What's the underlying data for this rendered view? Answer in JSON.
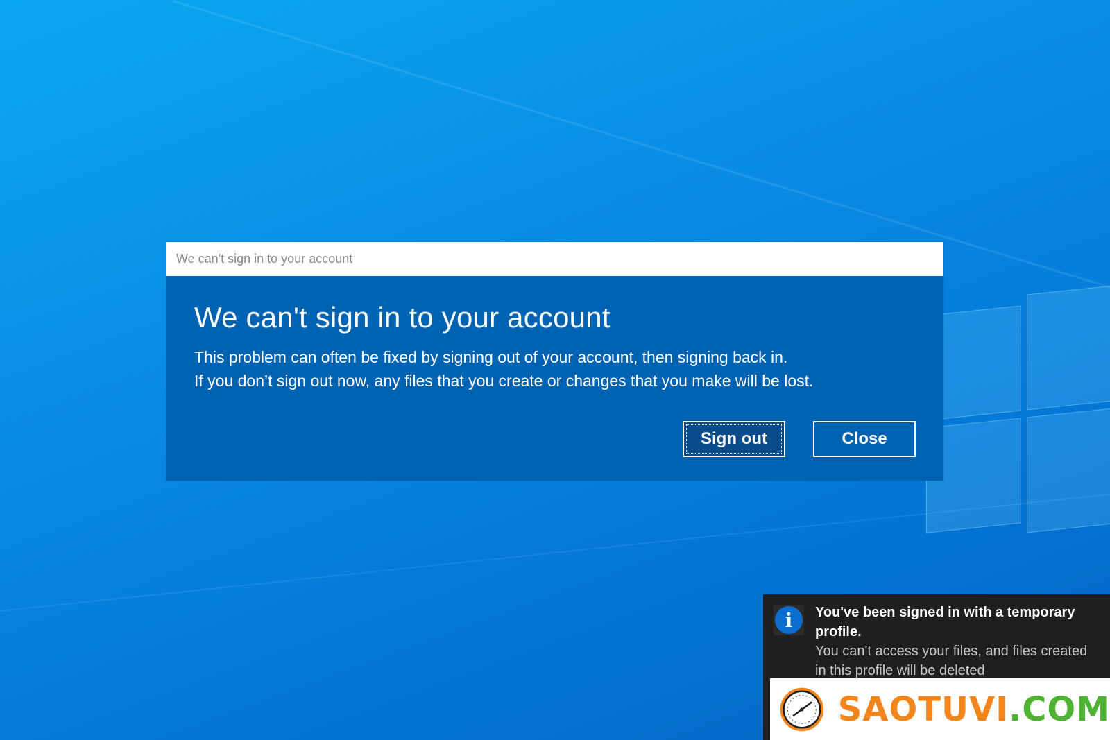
{
  "dialog": {
    "window_title": "We can't sign in to your account",
    "heading": "We can't sign in to your account",
    "message_line1": "This problem can often be fixed by signing out of your account, then signing back in.",
    "message_line2": "If you don’t sign out now, any files that you create or changes that you make will be lost.",
    "sign_out_label": "Sign out",
    "close_label": "Close",
    "accent_color": "#0063b1"
  },
  "notification": {
    "icon": "info-icon",
    "title": "You've been signed in with a temporary profile.",
    "body": "You can't access your files, and files created in this profile will be deleted"
  },
  "watermark": {
    "brand_a": "SAOTUVI",
    "brand_b": ".COM",
    "brand_a_color": "#f2861d",
    "brand_b_color": "#4fb233"
  }
}
